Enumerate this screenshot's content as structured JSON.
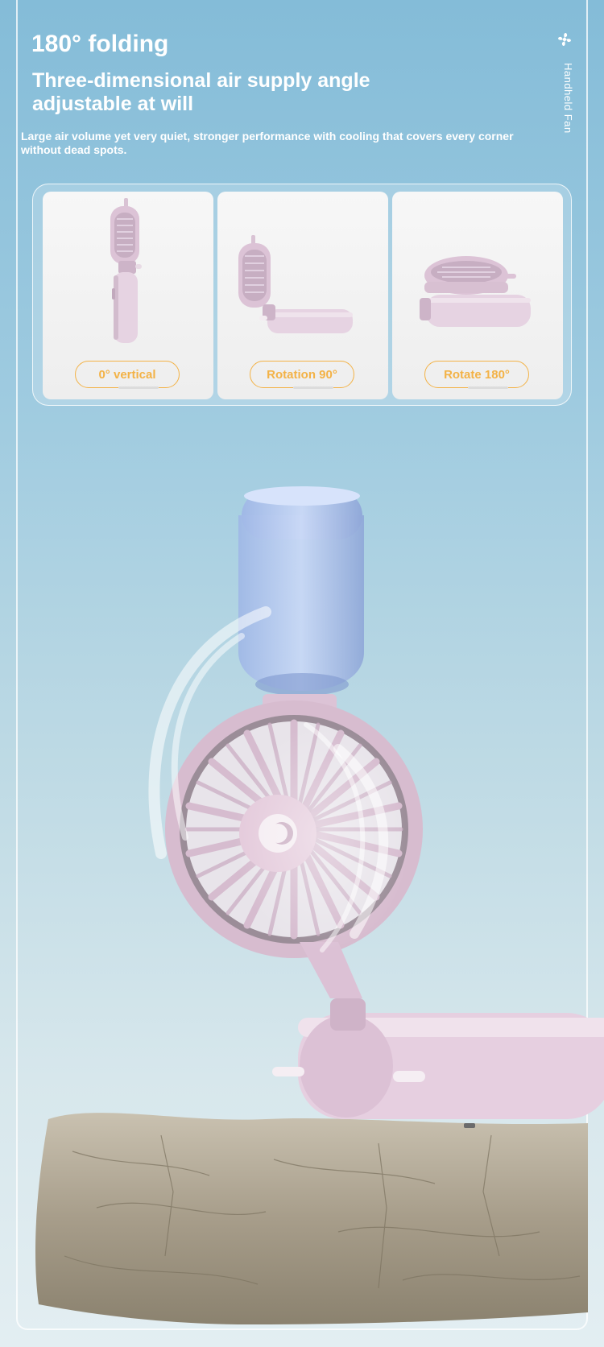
{
  "header": {
    "headline": "180° folding",
    "subhead": "Three-dimensional air supply angle adjustable at will",
    "description": "Large air volume yet very quiet, stronger performance with cooling that covers every corner without dead spots."
  },
  "brand": {
    "label": "Handheld Fan",
    "icon": "fan-icon"
  },
  "modes": [
    {
      "label": "0° vertical"
    },
    {
      "label": "Rotation 90°"
    },
    {
      "label": "Rotate 180°"
    }
  ],
  "colors": {
    "accent": "#f3b246",
    "fan_body": "#e3c9dc",
    "background_top": "#84bcd8",
    "background_bottom": "#e3eef2"
  }
}
